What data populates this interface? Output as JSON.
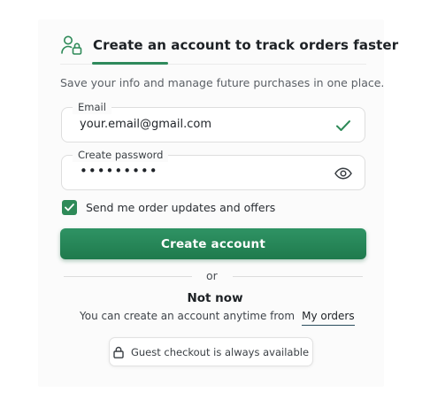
{
  "header": {
    "title": "Create an account to track orders faster",
    "icon": "user-lock-icon"
  },
  "subtitle": "Save your info and manage future purchases in one place.",
  "email_field": {
    "label": "Email",
    "value": "your.email@gmail.com",
    "status_icon": "checkmark-icon"
  },
  "password_field": {
    "label": "Create password",
    "value": "•••••••••",
    "toggle_icon": "eye-icon"
  },
  "opt_in": {
    "checked": true,
    "label": "Send me order updates and offers"
  },
  "primary_button": {
    "label": "Create account"
  },
  "separator": {
    "label": "or"
  },
  "secondary": {
    "title": "Not now",
    "helper_text": "You can create an account anytime from",
    "link_label": "My orders"
  },
  "guest_badge": {
    "label": "Guest checkout is always available",
    "icon": "lock-icon"
  },
  "colors": {
    "accent": "#2e8a58",
    "button_top": "#2f9364",
    "button_bottom": "#1f7a4d",
    "text": "#1d2125",
    "muted": "#5b6066"
  }
}
